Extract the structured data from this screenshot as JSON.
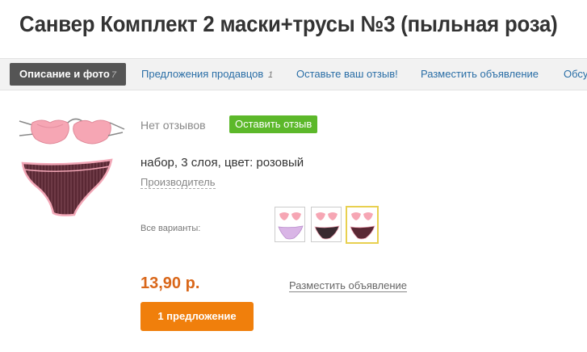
{
  "product": {
    "title": "Санвер Комплект 2 маски+трусы №3 (пыльная роза)",
    "description": "набор, 3 слоя, цвет: розовый",
    "manufacturer_link": "Производитель",
    "price": "13,90 р."
  },
  "tabs": [
    {
      "label": "Описание и фото",
      "count": "7"
    },
    {
      "label": "Предложения продавцов",
      "count": "1"
    },
    {
      "label": "Оставьте ваш отзыв!"
    },
    {
      "label": "Разместить объявление"
    },
    {
      "label": "Обсу"
    }
  ],
  "reviews": {
    "none_text": "Нет отзывов",
    "leave_button": "Оставить отзыв"
  },
  "variants": {
    "label": "Все варианты:"
  },
  "actions": {
    "post_ad_link": "Разместить объявление",
    "offers_button": "1 предложение"
  },
  "colors": {
    "accent_orange": "#f07f0c",
    "price_orange": "#d9671a",
    "review_green": "#5cb82a",
    "link_blue": "#2a6ea6",
    "active_tab": "#555555"
  }
}
